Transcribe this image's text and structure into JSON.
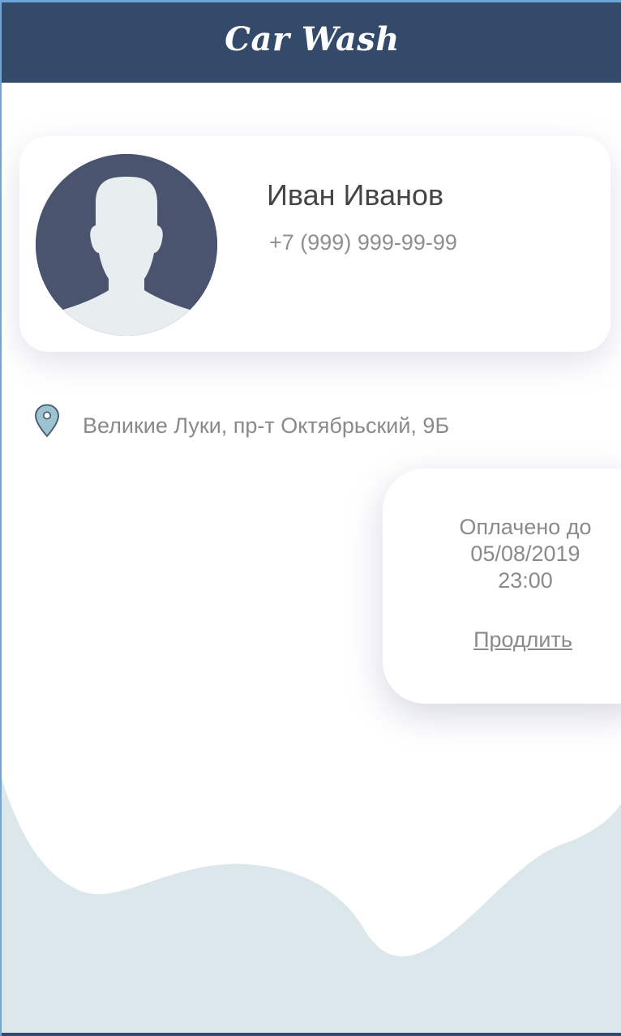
{
  "header": {
    "title": "Car Wash"
  },
  "profile": {
    "avatar_icon": "user-silhouette-icon",
    "name": "Иван Иванов",
    "phone": "+7 (999) 999-99-99"
  },
  "location": {
    "icon": "map-pin-icon",
    "address": "Великие Луки, пр-т Октябрьский, 9Б"
  },
  "payment": {
    "paid_label": "Оплачено до",
    "paid_date": "05/08/2019",
    "paid_time": "23:00",
    "extend_label": "Продлить"
  },
  "colors": {
    "header_bg": "#344a6a",
    "avatar_bg": "#4a546f",
    "wave": "#dbe7eb",
    "pin": "#9cc3cf",
    "text_gray": "#8a8a8a"
  }
}
